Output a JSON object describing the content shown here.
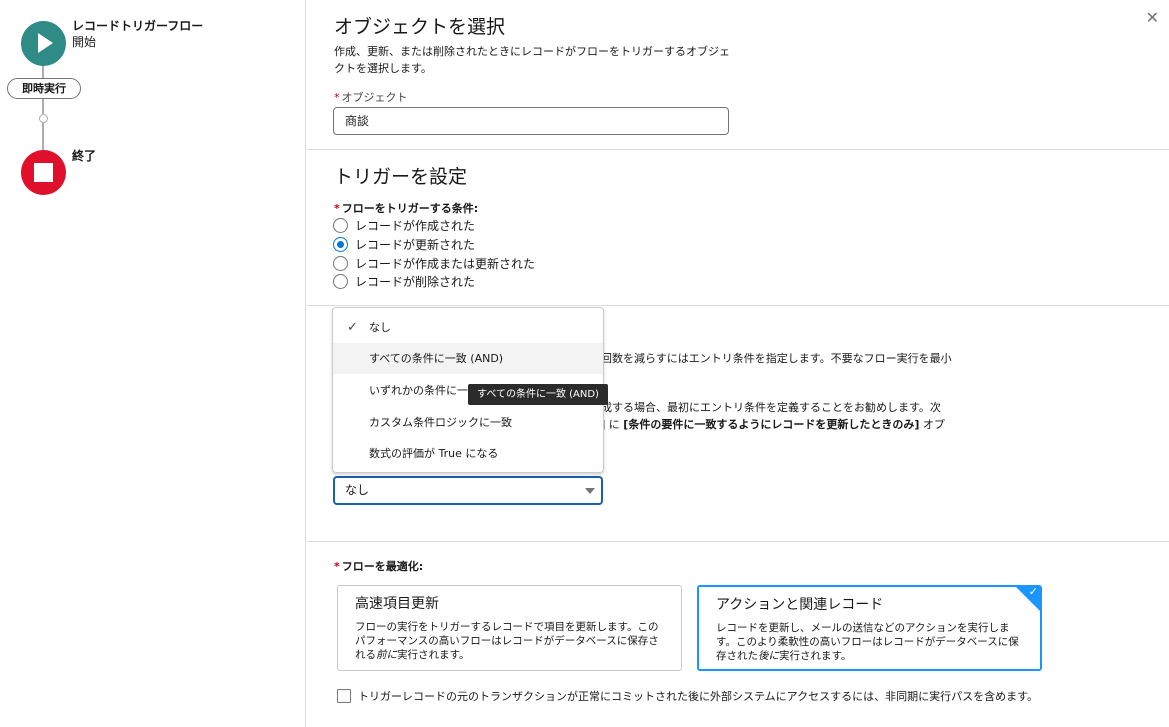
{
  "canvas": {
    "start_title": "レコードトリガーフロー",
    "start_sub": "開始",
    "run_label": "即時実行",
    "end_title": "終了"
  },
  "object_section": {
    "title": "オブジェクトを選択",
    "desc_line1": "作成、更新、または削除されたときにレコードがフローをトリガーするオブジェ",
    "desc_line2": "クトを選択します。",
    "field_label": "オブジェクト",
    "field_value": "商談"
  },
  "trigger_section": {
    "title": "トリガーを設定",
    "condition_label": "フローをトリガーする条件:",
    "options": [
      {
        "label": "レコードが作成された",
        "selected": false
      },
      {
        "label": "レコードが更新された",
        "selected": true
      },
      {
        "label": "レコードが作成または更新された",
        "selected": false
      },
      {
        "label": "レコードが削除された",
        "selected": false
      }
    ]
  },
  "entry_section": {
    "hidden_line1": "回数を減らすにはエントリ条件を指定します。不要なフロー実行を最小",
    "hidden_line2": "成する場合、最初にエントリ条件を定義することをお勧めします。次",
    "hidden_line3_a": "] に",
    "hidden_line3_b": "[条件の要件に一致するようにレコードを更新したときのみ]",
    "hidden_line3_c": "オプ",
    "dropdown_items": [
      "なし",
      "すべての条件に一致 (AND)",
      "いずれかの条件に一",
      "カスタム条件ロジックに一致",
      "数式の評価が True になる"
    ],
    "tooltip": "すべての条件に一致 (AND)",
    "combo_value": "なし"
  },
  "optimize_section": {
    "label": "フローを最適化:",
    "cards": [
      {
        "title": "高速項目更新",
        "desc_a": "フローの実行をトリガーするレコードで項目を更新します。このパフォーマンスの高いフローはレコードがデータベースに保存される",
        "desc_em": "前に",
        "desc_b": "実行されます。"
      },
      {
        "title": "アクションと関連レコード",
        "desc_a": "レコードを更新し、メールの送信などのアクションを実行します。このより柔軟性の高いフローはレコードがデータベースに保存された",
        "desc_em": "後に",
        "desc_b": "実行されます。"
      }
    ],
    "checkbox_label": "トリガーレコードの元のトランザクションが正常にコミットされた後に外部システムにアクセスするには、非同期に実行パスを含めます。"
  },
  "colors": {
    "start_node": "#2e8b85",
    "end_node": "#e0102d",
    "accent": "#0176d3",
    "selected_card": "#1b96ff"
  }
}
